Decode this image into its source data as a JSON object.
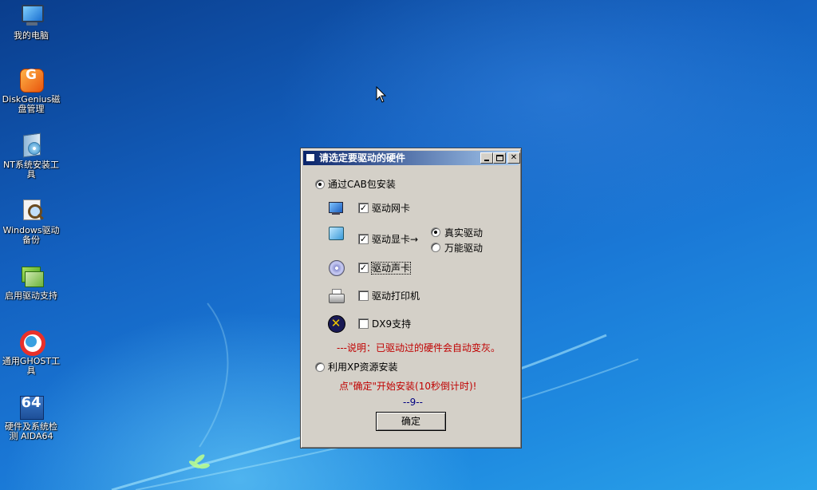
{
  "desktop": {
    "icons": [
      {
        "label": "我的电脑",
        "icon": "computer-icon"
      },
      {
        "label": "DiskGenius磁盘管理",
        "icon": "diskgenius-icon"
      },
      {
        "label": "NT系统安装工具",
        "icon": "nt-setup-icon"
      },
      {
        "label": "Windows驱动备份",
        "icon": "driver-backup-icon"
      },
      {
        "label": "启用驱动支持",
        "icon": "driver-support-icon"
      },
      {
        "label": "通用GHOST工具",
        "icon": "ghost-icon"
      },
      {
        "label": "硬件及系统检测 AIDA64",
        "icon": "aida64-icon"
      }
    ],
    "dg_glyph": "G",
    "aida_glyph": "64"
  },
  "dialog": {
    "title": "请选定要驱动的硬件",
    "option_cab": {
      "label": "通过CAB包安装",
      "selected": true
    },
    "items": [
      {
        "label": "驱动网卡",
        "checked": true,
        "icon": "network-card-icon"
      },
      {
        "label": "驱动显卡→",
        "checked": true,
        "icon": "display-card-icon"
      },
      {
        "label": "驱动声卡",
        "checked": true,
        "icon": "sound-card-icon"
      },
      {
        "label": "驱动打印机",
        "checked": false,
        "icon": "printer-icon"
      },
      {
        "label": "DX9支持",
        "checked": false,
        "icon": "directx-icon"
      }
    ],
    "display_modes": [
      {
        "label": "真实驱动",
        "selected": true
      },
      {
        "label": "万能驱动",
        "selected": false
      }
    ],
    "note": "---说明：已驱动过的硬件会自动变灰。",
    "option_xp": {
      "label": "利用XP资源安装",
      "selected": false
    },
    "hint": "点\"确定\"开始安装(10秒倒计时)!",
    "countdown": "--9--",
    "ok_label": "确定",
    "check_mark": "✓",
    "dx_glyph": "✕"
  },
  "colors": {
    "title_start": "#0a246a",
    "title_end": "#a6caf0",
    "dialog_face": "#d4d0c8",
    "note_red": "#c00000",
    "countdown_blue": "#000080"
  }
}
